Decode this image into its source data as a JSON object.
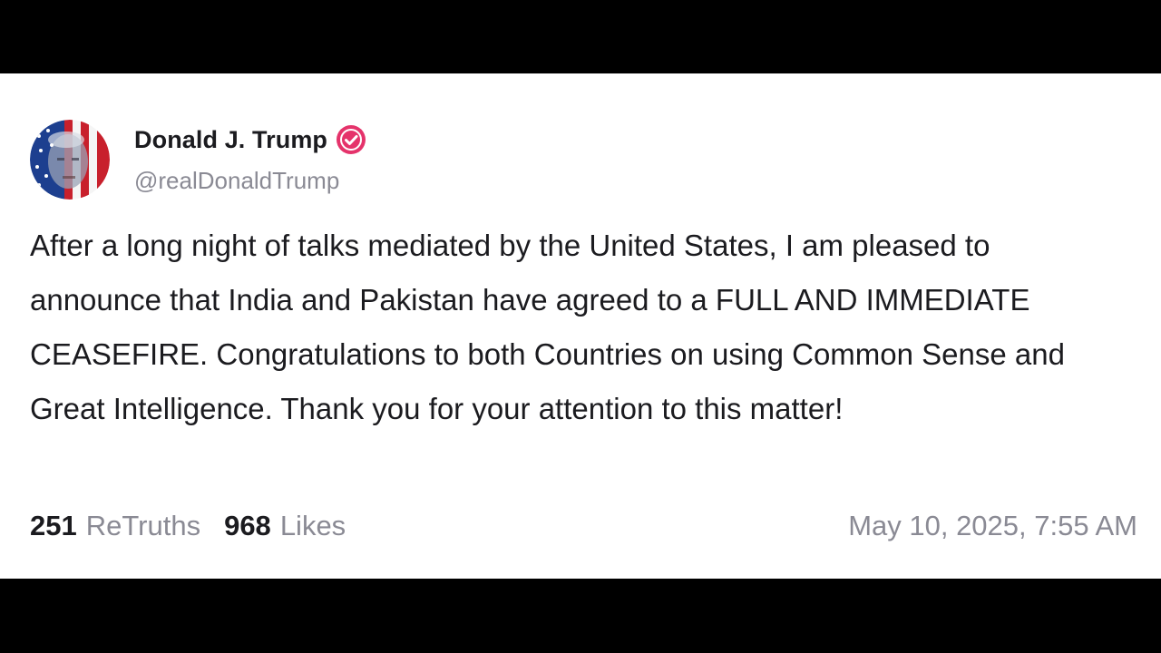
{
  "author": {
    "display_name": "Donald J. Trump",
    "handle": "@realDonaldTrump",
    "verified": true
  },
  "post": {
    "text": "After a long night of talks mediated by the United States, I am pleased to announce that India and Pakistan have agreed to a FULL AND IMMEDIATE CEASEFIRE. Congratulations to both Countries on using Common Sense and Great Intelligence. Thank you for your attention to this matter!"
  },
  "stats": {
    "retruths_count": "251",
    "retruths_label": "ReTruths",
    "likes_count": "968",
    "likes_label": "Likes"
  },
  "timestamp": "May 10, 2025, 7:55 AM",
  "colors": {
    "background": "#000000",
    "card": "#ffffff",
    "text": "#1b1b1f",
    "muted": "#8a8a94",
    "verified_badge": "#e5336b"
  },
  "icons": {
    "verified": "verified-badge-icon",
    "avatar": "avatar-portrait-flag"
  }
}
